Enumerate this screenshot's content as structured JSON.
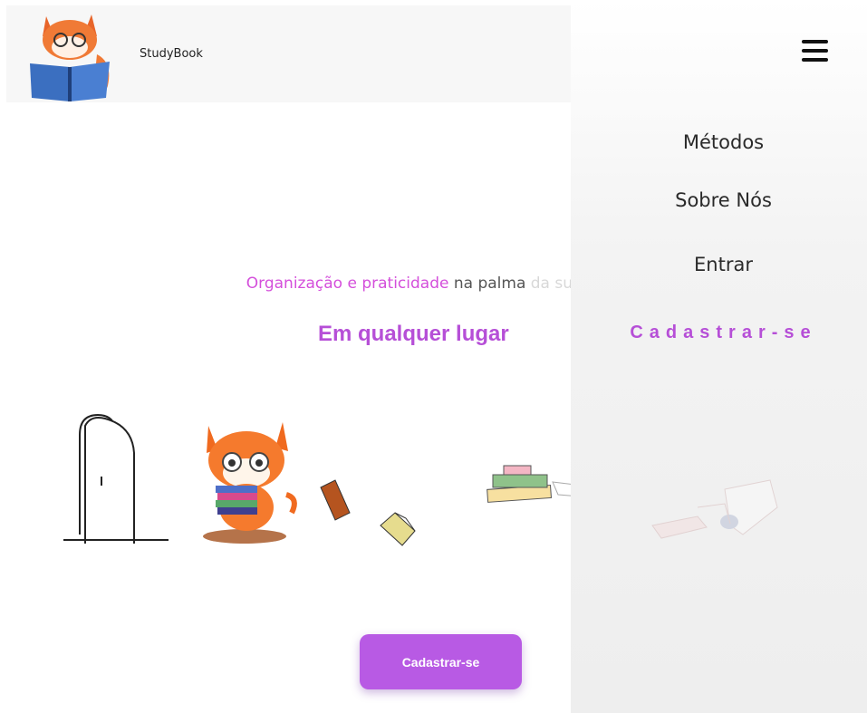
{
  "header": {
    "brand": "StudyBook"
  },
  "hero": {
    "tagline_accent": "Organização e praticidade",
    "tagline_mid": " na palma ",
    "tagline_faded": "da sua mão",
    "subtitle": "Em qualquer lugar",
    "cta_label": "Cadastrar-se"
  },
  "drawer": {
    "items": [
      "Métodos",
      "Sobre Nós",
      "Entrar"
    ],
    "signup_label": "Cadastrar-se"
  },
  "colors": {
    "accent": "#b64fd7",
    "accent_pink": "#d44fdb",
    "button": "#b85ae4",
    "fox": "#f06a1f"
  }
}
